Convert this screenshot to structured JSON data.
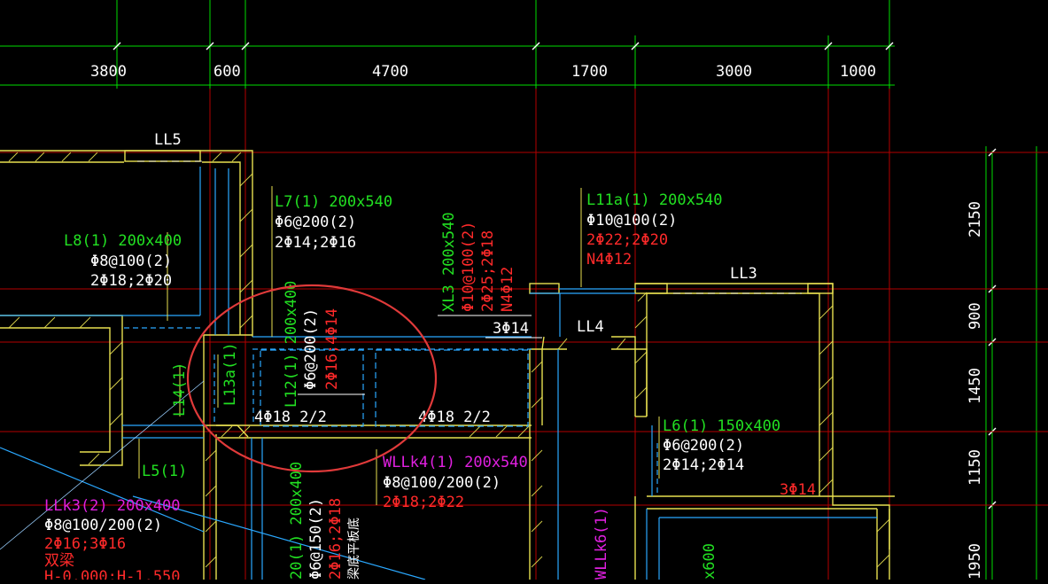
{
  "colors": {
    "background": "#000000",
    "grid_green": "#00dd00",
    "axis_red": "#cc0000",
    "wall_yellow": "#e8e050",
    "beam_cyan": "#2aa8ff",
    "text_green": "#22e022",
    "text_red": "#ff2a2a",
    "text_magenta": "#e020e0",
    "markup_circle": "#e03a3a"
  },
  "dims_top": [
    "3800",
    "600",
    "4700",
    "1700",
    "3000",
    "1000"
  ],
  "dims_right": [
    "2150",
    "900",
    "1450",
    "1150",
    "1950"
  ],
  "beams": {
    "ll5": "LL5",
    "ll3": "LL3",
    "ll4": "LL4",
    "l8": {
      "name": "L8(1) 200x400",
      "stirrup": "Φ8@100(2)",
      "rebar": "2Φ18;2Φ20"
    },
    "l7": {
      "name": "L7(1) 200x540",
      "stirrup": "Φ6@200(2)",
      "rebar": "2Φ14;2Φ16"
    },
    "xl3": {
      "name": "XL3 200x540",
      "stirrup": "Φ10@100(2)",
      "rebar": "2Φ25;2Φ18",
      "extra": "N4Φ12"
    },
    "l11a": {
      "name": "L11a(1) 200x540",
      "stirrup": "Φ10@100(2)",
      "rebar": "2Φ22;2Φ20",
      "extra": "N4Φ12"
    },
    "l12": {
      "name": "L12(1) 200x400",
      "stirrup": "Φ6@200(2)",
      "rebar": "2Φ16;4Φ14"
    },
    "l14": "L14(1)",
    "l13a": "L13a(1)",
    "l5": "L5(1)",
    "bot_left": "4Φ18 2/2",
    "bot_right": "4Φ18 2/2",
    "top_3": "3Φ14",
    "wllk4": {
      "name": "WLLk4(1) 200x540",
      "stirrup": "Φ8@100/200(2)",
      "rebar": "2Φ18;2Φ22"
    },
    "l6": {
      "name": "L6(1) 150x400",
      "stirrup": "Φ6@200(2)",
      "rebar": "2Φ14;2Φ14",
      "extra": "3Φ14"
    },
    "llk3": {
      "name": "LLk3(2) 200x400",
      "stirrup": "Φ8@100/200(2)",
      "rebar": "2Φ16;3Φ16",
      "note": "双梁",
      "elev": "H-0.000;H-1.550"
    },
    "l20": {
      "name": "20(1) 200x400",
      "stirrup": "Φ6@150(2)",
      "rebar": "2Φ16;2Φ18",
      "note": "梁底平板底"
    },
    "wllk6": "WLLk6(1)",
    "x600": "x600"
  }
}
